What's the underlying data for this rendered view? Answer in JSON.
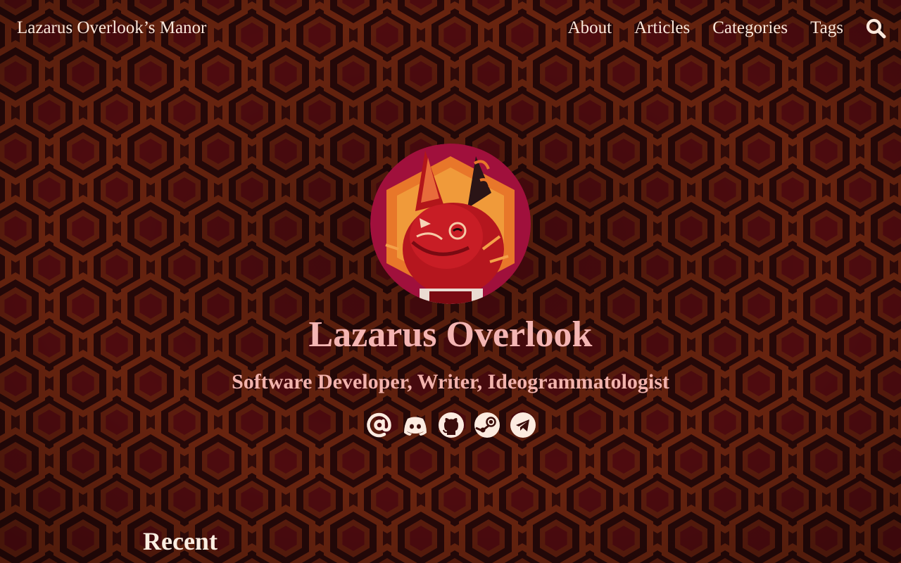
{
  "header": {
    "site_title": "Lazarus Overlook’s Manor",
    "nav": [
      {
        "label": "About"
      },
      {
        "label": "Articles"
      },
      {
        "label": "Categories"
      },
      {
        "label": "Tags"
      }
    ],
    "search_icon": "search-icon"
  },
  "profile": {
    "name": "Lazarus Overlook",
    "tagline": "Software Developer, Writer, Ideogrammatologist",
    "avatar": "avatar-illustration"
  },
  "socials": [
    {
      "icon": "at-icon"
    },
    {
      "icon": "discord-icon"
    },
    {
      "icon": "github-icon"
    },
    {
      "icon": "steam-icon"
    },
    {
      "icon": "telegram-icon"
    }
  ],
  "sections": {
    "recent_heading": "Recent"
  },
  "colors": {
    "background": "#3a0d0b",
    "pattern_orange": "#7a2810",
    "pattern_dark": "#2b0a0a",
    "pattern_red": "#6e0f14",
    "heading_pink": "#f4b5b3",
    "nav_text": "#fbe9dc"
  }
}
